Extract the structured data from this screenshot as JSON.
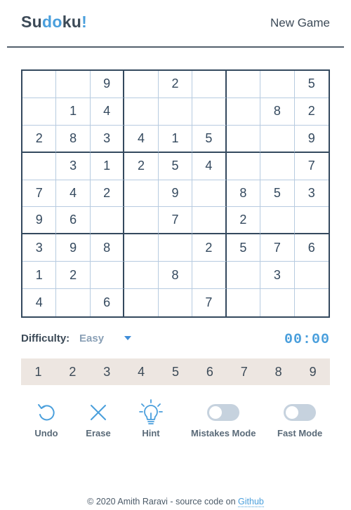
{
  "header": {
    "logo_parts": [
      "Su",
      "do",
      "ku",
      "!"
    ],
    "new_game": "New Game"
  },
  "grid": [
    [
      "",
      "",
      "9",
      "",
      "2",
      "",
      "",
      "",
      "5"
    ],
    [
      "",
      "1",
      "4",
      "",
      "",
      "",
      "",
      "8",
      "2"
    ],
    [
      "2",
      "8",
      "3",
      "4",
      "1",
      "5",
      "",
      "",
      "9"
    ],
    [
      "",
      "3",
      "1",
      "2",
      "5",
      "4",
      "",
      "",
      "7"
    ],
    [
      "7",
      "4",
      "2",
      "",
      "9",
      "",
      "8",
      "5",
      "3"
    ],
    [
      "9",
      "6",
      "",
      "",
      "7",
      "",
      "2",
      "",
      ""
    ],
    [
      "3",
      "9",
      "8",
      "",
      "",
      "2",
      "5",
      "7",
      "6"
    ],
    [
      "1",
      "2",
      "",
      "",
      "8",
      "",
      "",
      "3",
      ""
    ],
    [
      "4",
      "",
      "6",
      "",
      "",
      "7",
      "",
      "",
      ""
    ]
  ],
  "difficulty": {
    "label": "Difficulty:",
    "value": "Easy"
  },
  "timer": "00:00",
  "numpad": [
    "1",
    "2",
    "3",
    "4",
    "5",
    "6",
    "7",
    "8",
    "9"
  ],
  "controls": {
    "undo": "Undo",
    "erase": "Erase",
    "hint": "Hint",
    "mistakes_mode": "Mistakes Mode",
    "fast_mode": "Fast Mode"
  },
  "toggles": {
    "mistakes_mode_on": false,
    "fast_mode_on": false
  },
  "footer": {
    "text": "© 2020 Amith Raravi - source code on ",
    "link": "Github"
  },
  "colors": {
    "accent": "#4a9fdc",
    "dark": "#34495e",
    "numpad_bg": "#ede6e1"
  }
}
